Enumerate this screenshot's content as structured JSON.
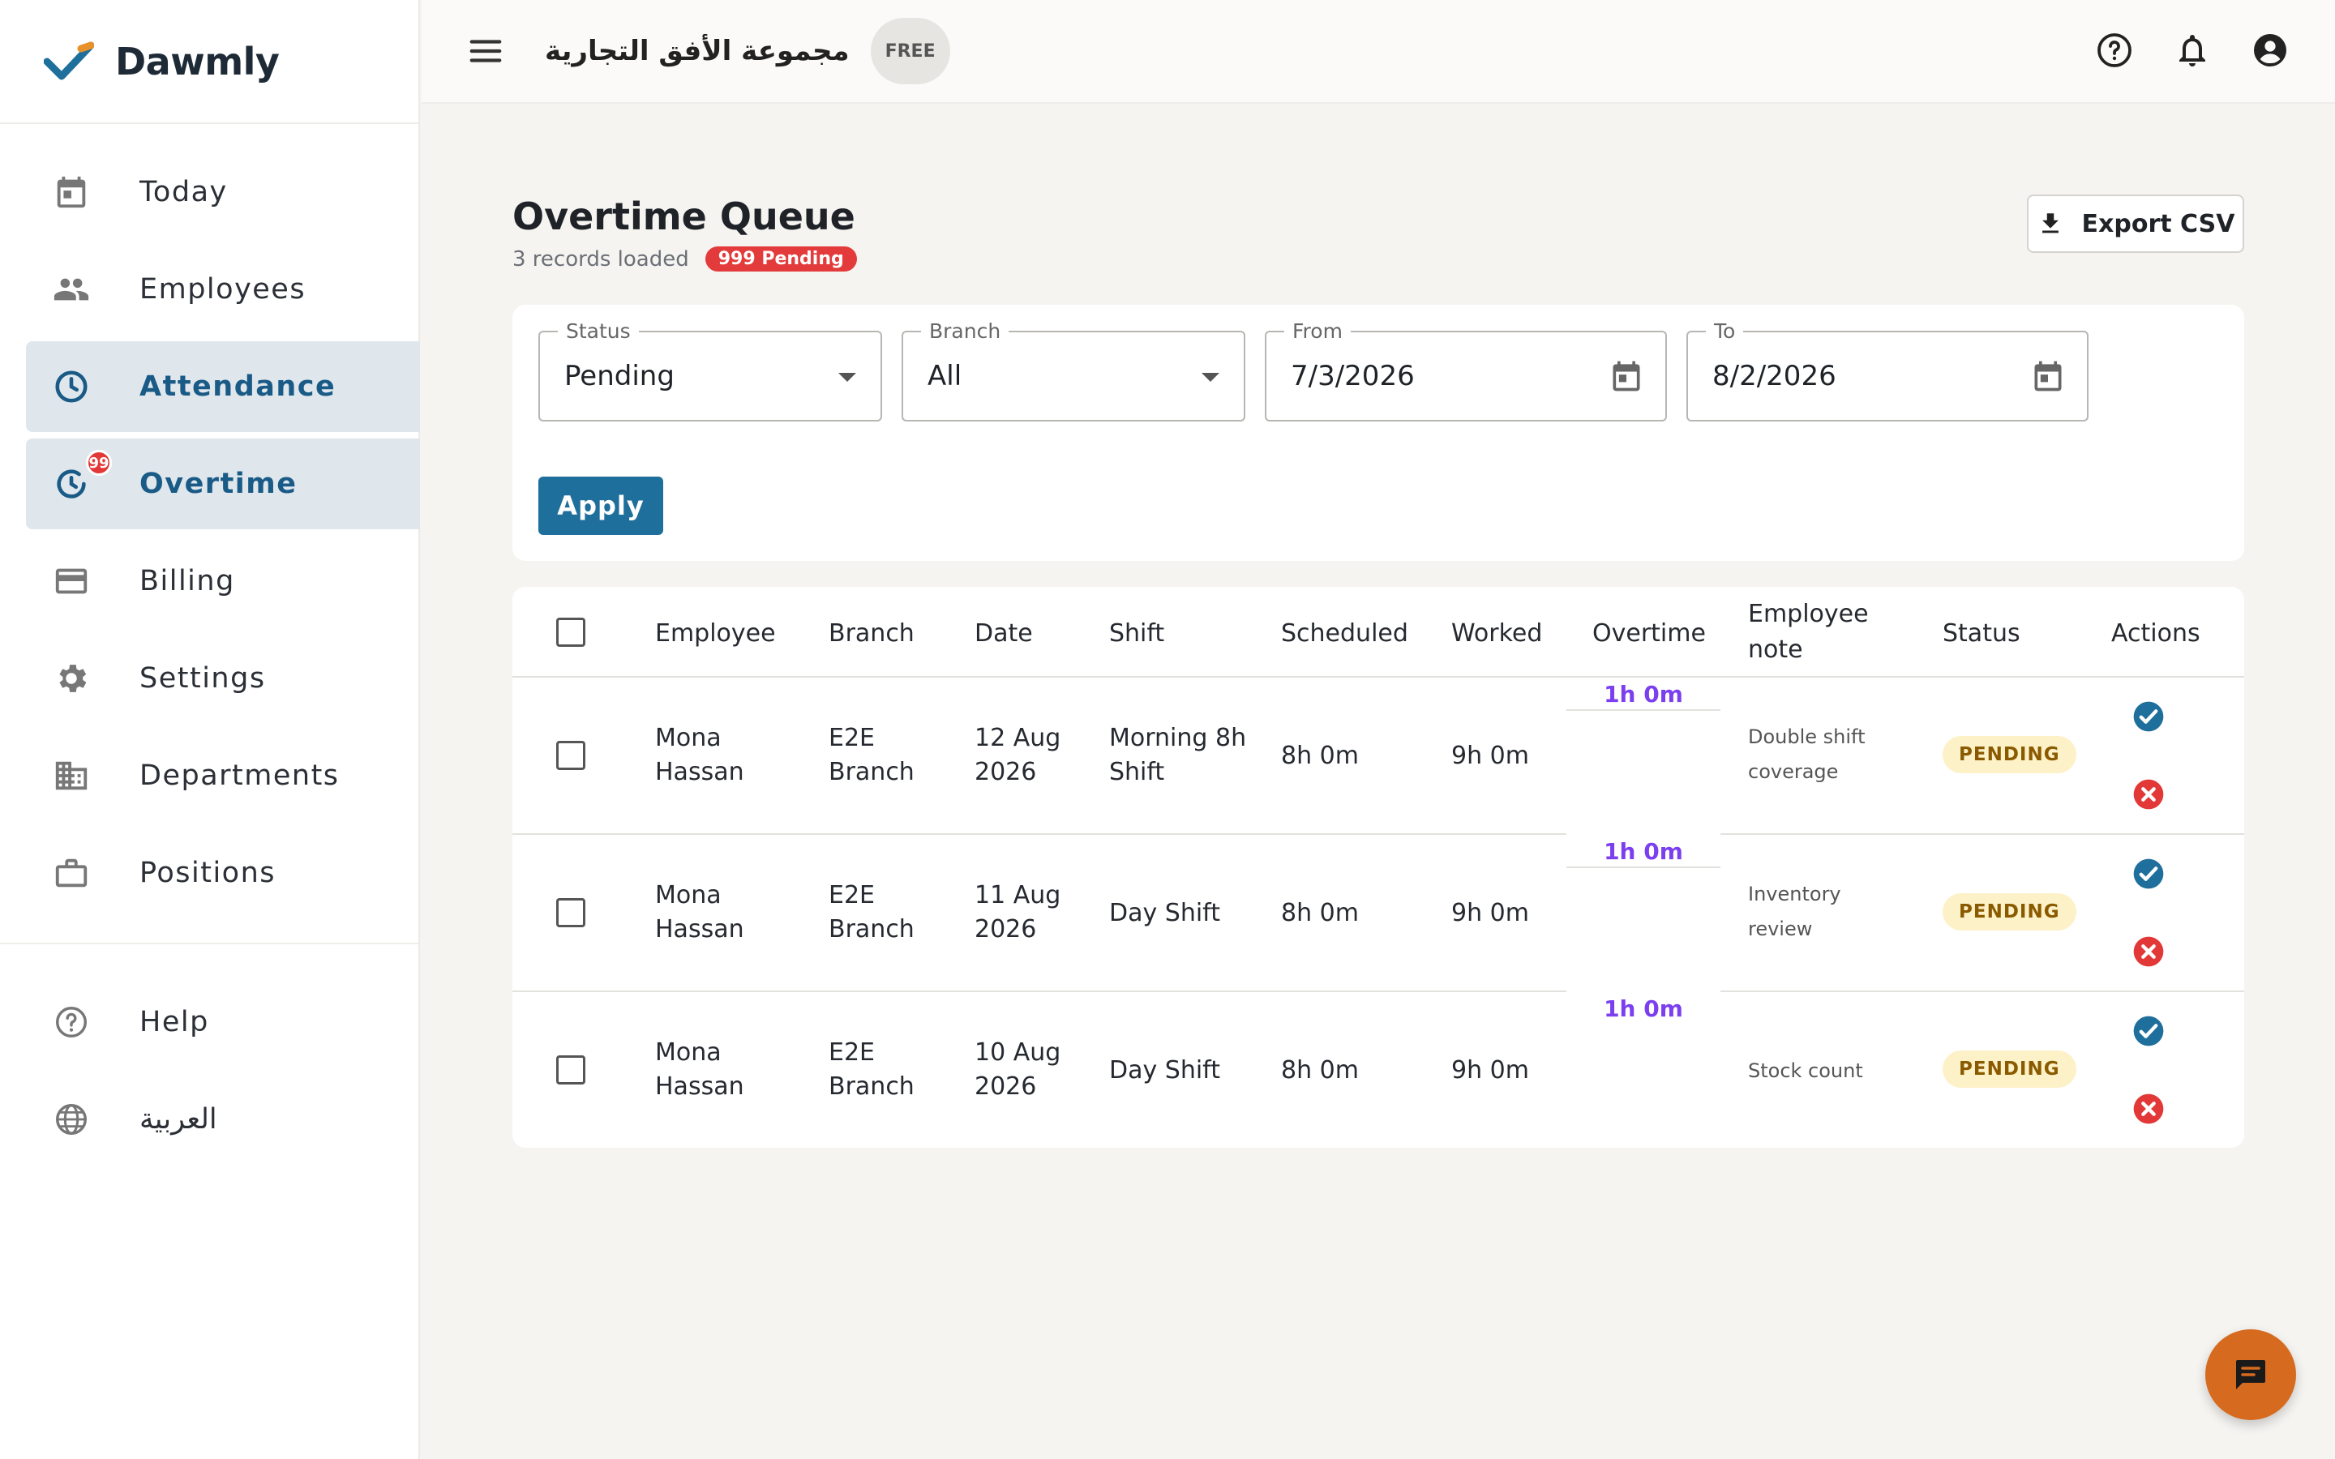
{
  "brand": {
    "name": "Dawmly"
  },
  "sidebar": {
    "items": [
      {
        "label": "Today",
        "icon": "calendar-icon",
        "active": false
      },
      {
        "label": "Employees",
        "icon": "people-icon",
        "active": false
      },
      {
        "label": "Attendance",
        "icon": "clock-icon",
        "active": true
      },
      {
        "label": "Overtime",
        "icon": "overtime-icon",
        "active": true,
        "badge": "99"
      },
      {
        "label": "Billing",
        "icon": "credit-card-icon",
        "active": false
      },
      {
        "label": "Settings",
        "icon": "gear-icon",
        "active": false
      },
      {
        "label": "Departments",
        "icon": "building-icon",
        "active": false
      },
      {
        "label": "Positions",
        "icon": "briefcase-icon",
        "active": false
      }
    ],
    "footer": [
      {
        "label": "Help",
        "icon": "help-icon"
      },
      {
        "label": "العربية",
        "icon": "globe-icon"
      }
    ]
  },
  "topbar": {
    "company": "مجموعة الأفق التجارية",
    "plan": "FREE"
  },
  "page": {
    "title": "Overtime Queue",
    "records": "3 records loaded",
    "pending_badge": "999 Pending",
    "export_label": "Export CSV"
  },
  "filters": {
    "status": {
      "label": "Status",
      "value": "Pending"
    },
    "branch": {
      "label": "Branch",
      "value": "All"
    },
    "from": {
      "label": "From",
      "value": "7/3/2026"
    },
    "to": {
      "label": "To",
      "value": "8/2/2026"
    },
    "apply_label": "Apply"
  },
  "table": {
    "headers": [
      "Employee",
      "Branch",
      "Date",
      "Shift",
      "Scheduled",
      "Worked",
      "Overtime",
      "Employee note",
      "Status",
      "Actions"
    ],
    "rows": [
      {
        "employee": "Mona Hassan",
        "branch": "E2E Branch",
        "date": "12 Aug 2026",
        "shift": "Morning 8h Shift",
        "scheduled": "8h 0m",
        "worked": "9h 0m",
        "overtime": "1h 0m",
        "note": "Double shift coverage",
        "status": "PENDING"
      },
      {
        "employee": "Mona Hassan",
        "branch": "E2E Branch",
        "date": "11 Aug 2026",
        "shift": "Day Shift",
        "scheduled": "8h 0m",
        "worked": "9h 0m",
        "overtime": "1h 0m",
        "note": "Inventory review",
        "status": "PENDING"
      },
      {
        "employee": "Mona Hassan",
        "branch": "E2E Branch",
        "date": "10 Aug 2026",
        "shift": "Day Shift",
        "scheduled": "8h 0m",
        "worked": "9h 0m",
        "overtime": "1h 0m",
        "note": "Stock count",
        "status": "PENDING"
      }
    ]
  },
  "colors": {
    "accent": "#1f6f9c",
    "pending_red": "#e33b3b",
    "overtime_purple": "#7b3ff0",
    "approve": "#1f6f9c",
    "reject": "#e33838",
    "chat_fab": "#d66a1f"
  }
}
